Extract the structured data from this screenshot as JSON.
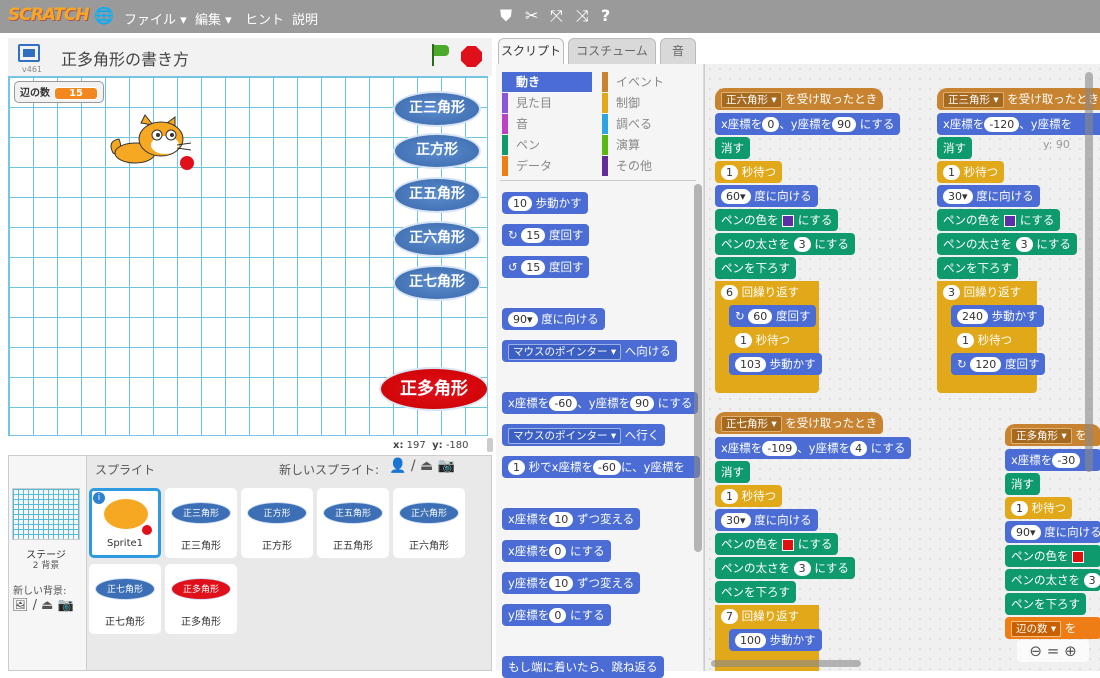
{
  "app": {
    "logo": "SCRATCH"
  },
  "menu": {
    "file": "ファイル ▾",
    "edit": "編集 ▾",
    "hint": "ヒント",
    "about": "説明"
  },
  "icons": {
    "globe": "globe-icon",
    "duplicate": "stamp-icon",
    "cut": "cut-icon",
    "grow": "grow-icon",
    "shrink": "shrink-icon",
    "help": "help-icon"
  },
  "stage": {
    "title": "正多角形の書き方",
    "version": "v461",
    "monitor_label": "辺の数",
    "monitor_value": "15",
    "coord_x_label": "x:",
    "coord_x": "197",
    "coord_y_label": "y:",
    "coord_y": "-180",
    "buttons": [
      "正三角形",
      "正方形",
      "正五角形",
      "正六角形",
      "正七角形"
    ],
    "big_button": "正多角形"
  },
  "sprites": {
    "header": "スプライト",
    "new_label": "新しいスプライト:",
    "stage_label": "ステージ",
    "stage_sub": "2 背景",
    "new_bg": "新しい背景:",
    "items": [
      {
        "name": "Sprite1",
        "selected": true,
        "label": ""
      },
      {
        "name": "正三角形",
        "label": "正三角形"
      },
      {
        "name": "正方形",
        "label": "正方形"
      },
      {
        "name": "正五角形",
        "label": "正五角形"
      },
      {
        "name": "正六角形",
        "label": "正六角形"
      },
      {
        "name": "正七角形",
        "label": "正七角形"
      },
      {
        "name": "正多角形",
        "label": "正多角形"
      }
    ]
  },
  "tabs": [
    "スクリプト",
    "コスチューム",
    "音"
  ],
  "categories": [
    {
      "label": "動き",
      "color": "#4a6cd4",
      "active": true
    },
    {
      "label": "イベント",
      "color": "#c88330"
    },
    {
      "label": "見た目",
      "color": "#8a55d7"
    },
    {
      "label": "制御",
      "color": "#e1a91a"
    },
    {
      "label": "音",
      "color": "#bb42c3"
    },
    {
      "label": "調べる",
      "color": "#2ca5e2"
    },
    {
      "label": "ペン",
      "color": "#0e9a6c"
    },
    {
      "label": "演算",
      "color": "#5cb712"
    },
    {
      "label": "データ",
      "color": "#ee7d16"
    },
    {
      "label": "その他",
      "color": "#632d99"
    }
  ],
  "palette": {
    "move": {
      "v": "10",
      "t": "歩動かす"
    },
    "turn_r": {
      "v": "15",
      "t": "度回す"
    },
    "turn_l": {
      "v": "15",
      "t": "度回す"
    },
    "point": {
      "v": "90▾",
      "t": "度に向ける"
    },
    "pointto": {
      "d": "マウスのポインター ▾",
      "t": "へ向ける"
    },
    "goxy": {
      "a": "x座標を",
      "x": "-60",
      "b": "、y座標を",
      "y": "90",
      "c": "にする"
    },
    "goto": {
      "d": "マウスのポインター ▾",
      "t": "へ行く"
    },
    "glide": {
      "v": "1",
      "a": "秒でx座標を",
      "x": "-60",
      "b": "に、y座標を"
    },
    "chx": {
      "a": "x座標を",
      "v": "10",
      "t": "ずつ変える"
    },
    "setx": {
      "a": "x座標を",
      "v": "0",
      "t": "にする"
    },
    "chy": {
      "a": "y座標を",
      "v": "10",
      "t": "ずつ変える"
    },
    "sety": {
      "a": "y座標を",
      "v": "0",
      "t": "にする"
    },
    "bounce": "もし端に着いたら、跳ね返る"
  },
  "script": {
    "y_readout": "y: 90",
    "s1": {
      "hat": "正六角形 ▾",
      "hat_t": "を受け取ったとき",
      "x": "0",
      "y": "90",
      "wait": "1",
      "dir": "60▾",
      "repeat": "6",
      "turn": "60",
      "wait2": "1",
      "steps": "103"
    },
    "s2": {
      "hat": "正三角形 ▾",
      "hat_t": "を受け取ったとき",
      "x": "-120",
      "wait": "1",
      "dir": "30▾",
      "repeat": "3",
      "steps": "240",
      "wait2": "1",
      "turn": "120"
    },
    "s3": {
      "hat": "正七角形 ▾",
      "hat_t": "を受け取ったとき",
      "x": "-109",
      "y": "4",
      "wait": "1",
      "dir": "30▾",
      "repeat": "7",
      "steps": "100"
    },
    "s4": {
      "hat": "正多角形 ▾",
      "hat_t": "を",
      "x": "-30",
      "wait": "1",
      "dir": "90▾",
      "var": "辺の数 ▾",
      "var_t": "を"
    },
    "labels": {
      "xset": "x座標を",
      "yset": "、y座標を",
      "set": "にする",
      "clear": "消す",
      "wait": "秒待つ",
      "dir": "度に向ける",
      "color": "ペンの色を",
      "size": "ペンの太さを",
      "size_v": "3",
      "down": "ペンを下ろす",
      "repeat": "回繰り返す",
      "turn": "度回す",
      "steps": "歩動かす",
      "setcolor": "にする"
    },
    "colors": {
      "purple": "#5a2fa8",
      "red": "#e01010"
    }
  }
}
